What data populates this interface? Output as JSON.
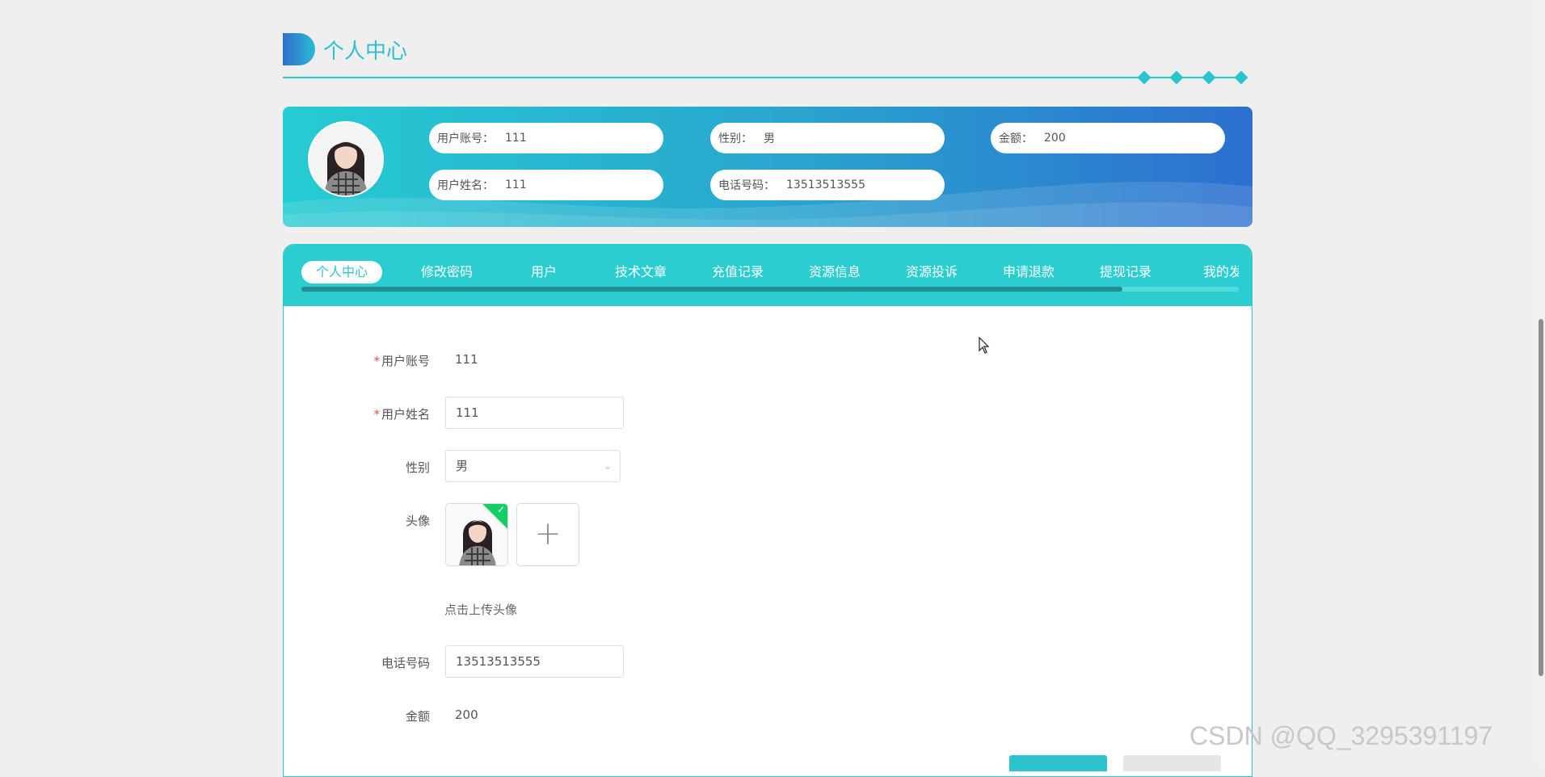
{
  "page": {
    "title": "个人中心"
  },
  "banner": {
    "account_label": "用户账号：",
    "account_value": "111",
    "gender_label": "性别：",
    "gender_value": "男",
    "amount_label": "金额：",
    "amount_value": "200",
    "name_label": "用户姓名：",
    "name_value": "111",
    "phone_label": "电话号码：",
    "phone_value": "13513513555"
  },
  "tabs": [
    {
      "label": "个人中心",
      "active": true
    },
    {
      "label": "修改密码"
    },
    {
      "label": "用户"
    },
    {
      "label": "技术文章"
    },
    {
      "label": "充值记录"
    },
    {
      "label": "资源信息"
    },
    {
      "label": "资源投诉"
    },
    {
      "label": "申请退款"
    },
    {
      "label": "提现记录"
    },
    {
      "label": "我的发"
    }
  ],
  "form": {
    "account_label": "用户账号",
    "account_value": "111",
    "name_label": "用户姓名",
    "name_value": "111",
    "gender_label": "性别",
    "gender_value": "男",
    "avatar_label": "头像",
    "upload_hint": "点击上传头像",
    "phone_label": "电话号码",
    "phone_value": "13513513555",
    "amount_label": "金额",
    "amount_value": "200"
  },
  "watermark": "CSDN @QQ_3295391197",
  "colors": {
    "accent": "#2cc4cc",
    "banner_start": "#26ccd3",
    "banner_end": "#2c6fd0",
    "required": "#e05050",
    "upload_success": "#13ce66"
  },
  "icons": [
    "avatar-photo",
    "plus-icon",
    "check-icon",
    "chevron-down-icon",
    "mouse-cursor-icon"
  ]
}
